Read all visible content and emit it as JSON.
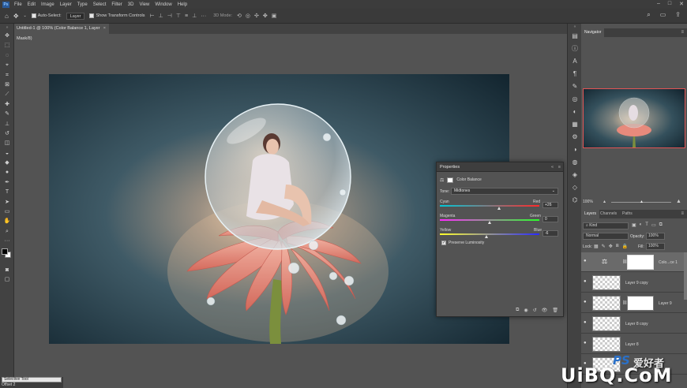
{
  "menubar": {
    "items": [
      "File",
      "Edit",
      "Image",
      "Layer",
      "Type",
      "Select",
      "Filter",
      "3D",
      "View",
      "Window",
      "Help"
    ]
  },
  "options": {
    "auto_select_label": "Auto-Select:",
    "auto_select_target": "Layer",
    "show_transform_label": "Show Transform Controls",
    "mode_3d_label": "3D Mode:"
  },
  "document_tab": {
    "title": "Untitled-1 @ 100% (Color Balance 1, Layer Mask/8)",
    "close": "×"
  },
  "navigator": {
    "tab_label": "Navigator",
    "zoom_value": "100%"
  },
  "properties": {
    "title": "Properties",
    "subtitle": "Color Balance",
    "tone_label": "Tone:",
    "tone_value": "Midtones",
    "sliders": [
      {
        "left": "Cyan",
        "right": "Red",
        "value": "+26",
        "position": 0.6
      },
      {
        "left": "Magenta",
        "right": "Green",
        "value": "0",
        "position": 0.5
      },
      {
        "left": "Yellow",
        "right": "Blue",
        "value": "-6",
        "position": 0.47
      }
    ],
    "preserve_luminosity_label": "Preserve Luminosity",
    "preserve_luminosity_checked": true
  },
  "layers_panel": {
    "tabs": [
      "Layers",
      "Channels",
      "Paths"
    ],
    "kind_filter": "Kind",
    "blend_mode": "Normal",
    "opacity_label": "Opacity:",
    "opacity_value": "100%",
    "lock_label": "Lock:",
    "fill_label": "Fill:",
    "fill_value": "100%",
    "layers": [
      {
        "name": "Colo...ce 1",
        "has_mask": true,
        "adjustment": true
      },
      {
        "name": "Layer 9 copy",
        "has_mask": false
      },
      {
        "name": "Layer 9",
        "has_mask": true
      },
      {
        "name": "Layer 8 copy",
        "has_mask": false
      },
      {
        "name": "Layer 8",
        "has_mask": false
      },
      {
        "name": "",
        "has_mask": false
      }
    ]
  },
  "status": {
    "tool_label": "Selective Tool",
    "offset_label": "Offset 2"
  },
  "watermark": {
    "text_main": "UiBQ.CoM",
    "text_ps": "PS",
    "text_cn": "爱好者"
  },
  "colors": {
    "accent": "#e35454",
    "panel_bg": "#535353",
    "dark_bg": "#3c3c3c"
  }
}
